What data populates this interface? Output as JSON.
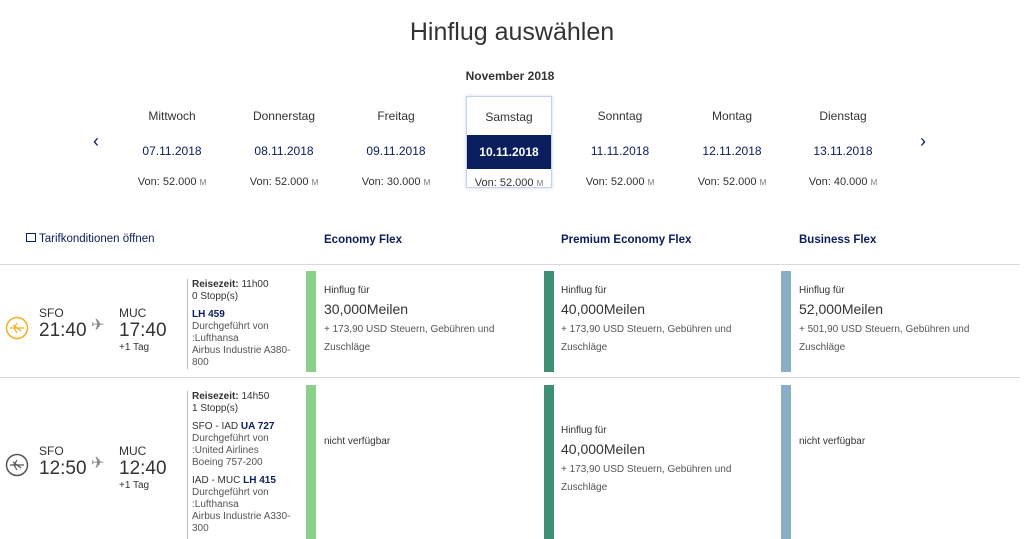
{
  "title": "Hinflug auswählen",
  "month": "November 2018",
  "nav": {
    "prev": "‹",
    "next": "›"
  },
  "days": [
    {
      "name": "Mittwoch",
      "date": "07.11.2018",
      "price_prefix": "Von: 52.000",
      "unit": "M",
      "selected": false
    },
    {
      "name": "Donnerstag",
      "date": "08.11.2018",
      "price_prefix": "Von: 52.000",
      "unit": "M",
      "selected": false
    },
    {
      "name": "Freitag",
      "date": "09.11.2018",
      "price_prefix": "Von: 30.000",
      "unit": "M",
      "selected": false
    },
    {
      "name": "Samstag",
      "date": "10.11.2018",
      "price_prefix": "Von: 52.000",
      "unit": "M",
      "selected": true
    },
    {
      "name": "Sonntag",
      "date": "11.11.2018",
      "price_prefix": "Von: 52.000",
      "unit": "M",
      "selected": false
    },
    {
      "name": "Montag",
      "date": "12.11.2018",
      "price_prefix": "Von: 52.000",
      "unit": "M",
      "selected": false
    },
    {
      "name": "Dienstag",
      "date": "13.11.2018",
      "price_prefix": "Von: 40.000",
      "unit": "M",
      "selected": false
    }
  ],
  "tarif_link": "Tarifkonditionen öffnen",
  "fare_classes": [
    "Economy Flex",
    "Premium Economy Flex",
    "Business Flex"
  ],
  "colors": {
    "navy": "#0a1d5c",
    "economy": "#8ccf8a",
    "premium": "#3f8f72",
    "business": "#8aaec6",
    "lufthansa_yellow": "#f2b01e"
  },
  "flights": [
    {
      "from": "SFO",
      "dep": "21:40",
      "to": "MUC",
      "arr": "17:40",
      "plus_day": "+1 Tag",
      "travel_label": "Reisezeit:",
      "travel_time": "11h00",
      "stops": "0 Stopp(s)",
      "segments": [
        {
          "route": "",
          "flight_no": "LH 459",
          "operated": "Durchgeführt von",
          "carrier": ":Lufthansa",
          "aircraft": "Airbus Industrie A380-",
          "aircraft2": "800"
        }
      ],
      "fares": [
        {
          "available": true,
          "label": "Hinflug für",
          "miles": "30,000",
          "miles_unit": "Meilen",
          "tax": "+ 173,90 USD Steuern, Gebühren und",
          "tax2": "Zuschläge"
        },
        {
          "available": true,
          "label": "Hinflug für",
          "miles": "40,000",
          "miles_unit": "Meilen",
          "tax": "+ 173,90 USD Steuern, Gebühren und",
          "tax2": "Zuschläge"
        },
        {
          "available": true,
          "label": "Hinflug für",
          "miles": "52,000",
          "miles_unit": "Meilen",
          "tax": "+ 501,90 USD Steuern, Gebühren und",
          "tax2": "Zuschläge"
        }
      ]
    },
    {
      "from": "SFO",
      "dep": "12:50",
      "to": "MUC",
      "arr": "12:40",
      "plus_day": "+1 Tag",
      "travel_label": "Reisezeit:",
      "travel_time": "14h50",
      "stops": "1 Stopp(s)",
      "segments": [
        {
          "route": "SFO - IAD",
          "flight_no": "UA 727",
          "operated": "Durchgeführt von",
          "carrier": ":United Airlines",
          "aircraft": "Boeing 757-200",
          "aircraft2": ""
        },
        {
          "route": "IAD - MUC",
          "flight_no": "LH 415",
          "operated": "Durchgeführt von",
          "carrier": ":Lufthansa",
          "aircraft": "Airbus Industrie A330-",
          "aircraft2": "300"
        }
      ],
      "fares": [
        {
          "available": false,
          "na": "nicht verfügbar"
        },
        {
          "available": true,
          "label": "Hinflug für",
          "miles": "40,000",
          "miles_unit": "Meilen",
          "tax": "+ 173,90 USD Steuern, Gebühren und",
          "tax2": "Zuschläge"
        },
        {
          "available": false,
          "na": "nicht verfügbar"
        }
      ]
    }
  ]
}
